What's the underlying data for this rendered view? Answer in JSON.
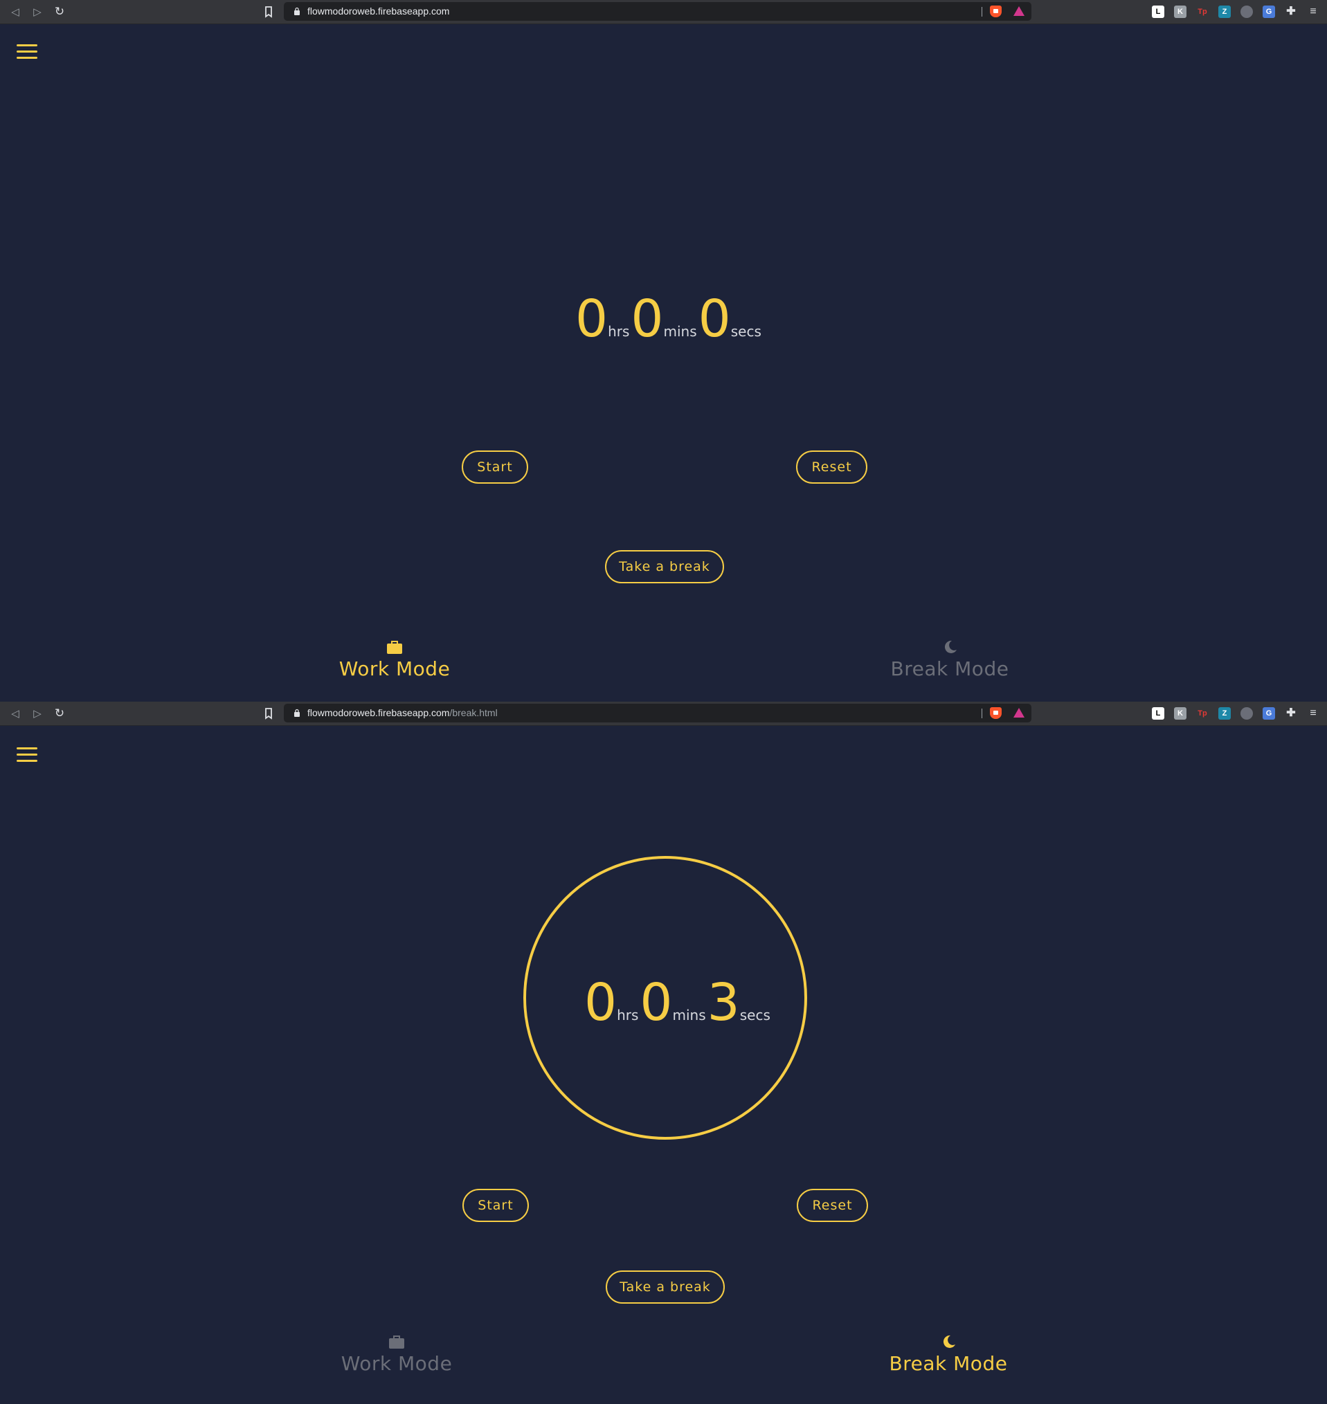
{
  "colors": {
    "accent": "#f6cd45",
    "background": "#1d2339",
    "inactive": "#6b6e78",
    "browser_toolbar": "#35363a"
  },
  "screens": [
    {
      "url": {
        "domain": "flowmodoroweb.firebaseapp.com",
        "path": ""
      },
      "timer": {
        "hours": "0",
        "hours_unit": "hrs",
        "minutes": "0",
        "minutes_unit": "mins",
        "seconds": "0",
        "seconds_unit": "secs"
      },
      "buttons": {
        "start": "Start",
        "reset": "Reset",
        "take_break": "Take a break"
      },
      "modes": [
        {
          "label": "Work Mode",
          "icon": "briefcase-icon",
          "active": true
        },
        {
          "label": "Break Mode",
          "icon": "moon-icon",
          "active": false
        }
      ]
    },
    {
      "url": {
        "domain": "flowmodoroweb.firebaseapp.com",
        "path": "/break.html"
      },
      "timer": {
        "hours": "0",
        "hours_unit": "hrs",
        "minutes": "0",
        "minutes_unit": "mins",
        "seconds": "3",
        "seconds_unit": "secs"
      },
      "buttons": {
        "start": "Start",
        "reset": "Reset",
        "take_break": "Take a break"
      },
      "modes": [
        {
          "label": "Work Mode",
          "icon": "briefcase-icon",
          "active": false
        },
        {
          "label": "Break Mode",
          "icon": "moon-icon",
          "active": true
        }
      ]
    }
  ],
  "extensions": [
    {
      "icon": "l-extension-icon",
      "text": "L"
    },
    {
      "icon": "k-extension-icon",
      "text": "K"
    },
    {
      "icon": "tp-extension-icon",
      "text": "Tp"
    },
    {
      "icon": "zt-extension-icon",
      "text": "Z"
    },
    {
      "icon": "chat-extension-icon",
      "text": ""
    },
    {
      "icon": "translate-extension-icon",
      "text": "G"
    },
    {
      "icon": "puzzle-icon",
      "text": ""
    },
    {
      "icon": "browser-menu-icon",
      "text": ""
    }
  ]
}
